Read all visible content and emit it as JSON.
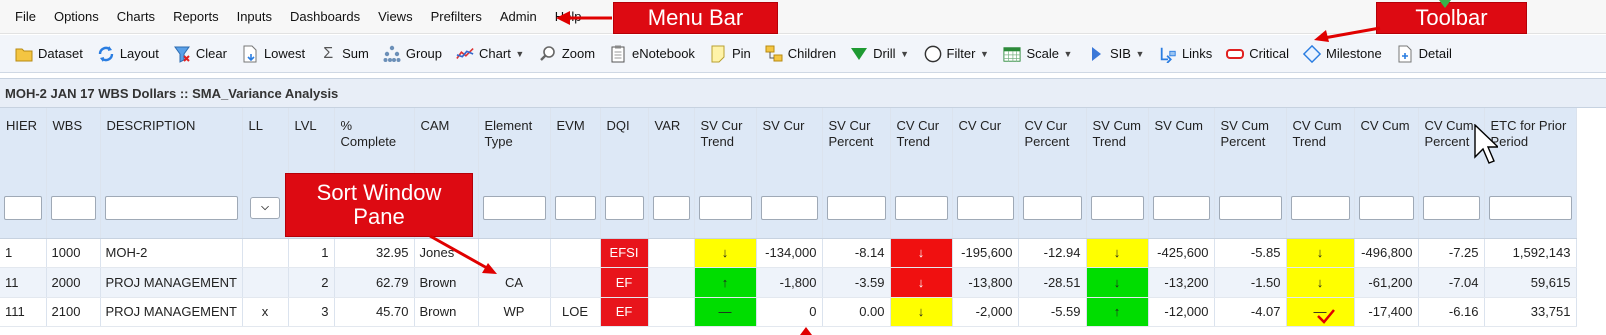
{
  "menu": [
    "File",
    "Options",
    "Charts",
    "Reports",
    "Inputs",
    "Dashboards",
    "Views",
    "Prefilters",
    "Admin",
    "Help"
  ],
  "toolbar": [
    {
      "label": "Dataset",
      "icon": "folder-icon"
    },
    {
      "label": "Layout",
      "icon": "refresh-layout-icon"
    },
    {
      "label": "Clear",
      "icon": "clear-filter-icon"
    },
    {
      "label": "Lowest",
      "icon": "lowest-page-icon"
    },
    {
      "label": "Sum",
      "icon": "sigma-icon"
    },
    {
      "label": "Group",
      "icon": "hierarchy-icon"
    },
    {
      "label": "Chart",
      "icon": "line-chart-icon",
      "dropdown": true
    },
    {
      "label": "Zoom",
      "icon": "magnifier-icon"
    },
    {
      "label": "eNotebook",
      "icon": "notebook-icon"
    },
    {
      "label": "Pin",
      "icon": "note-pin-icon"
    },
    {
      "label": "Children",
      "icon": "children-icon"
    },
    {
      "label": "Drill",
      "icon": "drill-down-triangle-icon",
      "dropdown": true
    },
    {
      "label": "Filter",
      "icon": "filter-circle-icon",
      "dropdown": true
    },
    {
      "label": "Scale",
      "icon": "calendar-scale-icon",
      "dropdown": true
    },
    {
      "label": "SIB",
      "icon": "sib-arrow-icon",
      "dropdown": true
    },
    {
      "label": "Links",
      "icon": "links-icon"
    },
    {
      "label": "Critical",
      "icon": "critical-bar-icon"
    },
    {
      "label": "Milestone",
      "icon": "milestone-diamond-icon"
    },
    {
      "label": "Detail",
      "icon": "detail-page-icon"
    }
  ],
  "title": "MOH-2 JAN 17 WBS Dollars :: SMA_Variance Analysis",
  "columns": [
    "HIER",
    "WBS",
    "DESCRIPTION",
    "LL",
    "LVL",
    "% Complete",
    "CAM",
    "Element Type",
    "EVM",
    "DQI",
    "VAR",
    "SV Cur Trend",
    "SV Cur",
    "SV Cur Percent",
    "CV Cur Trend",
    "CV Cur",
    "CV Cur Percent",
    "SV Cum Trend",
    "SV Cum",
    "SV Cum Percent",
    "CV Cum Trend",
    "CV Cum",
    "CV Cum Percent",
    "ETC for Prior Period"
  ],
  "rows": [
    {
      "hier": "1",
      "wbs": "1000",
      "desc": "MOH-2",
      "ll": "",
      "lvl": "1",
      "pct": "32.95",
      "cam": "Jones",
      "etype": "",
      "evm": "",
      "dqi": "EFSI",
      "var": "",
      "sv_cur_trend": "↓",
      "sv_cur": "-134,000",
      "sv_cur_pct": "-8.14",
      "cv_cur_trend": "↓",
      "cv_cur": "-195,600",
      "cv_cur_pct": "-12.94",
      "sv_cum_trend": "↓",
      "sv_cum": "-425,600",
      "sv_cum_pct": "-5.85",
      "cv_cum_trend": "↓",
      "cv_cum": "-496,800",
      "cv_cum_pct": "-7.25",
      "etc": "1,592,143"
    },
    {
      "hier": "11",
      "wbs": "2000",
      "desc": "PROJ MANAGEMENT",
      "ll": "",
      "lvl": "2",
      "pct": "62.79",
      "cam": "Brown",
      "etype": "CA",
      "evm": "",
      "dqi": "EF",
      "var": "",
      "sv_cur_trend": "↑",
      "sv_cur": "-1,800",
      "sv_cur_pct": "-3.59",
      "cv_cur_trend": "↓",
      "cv_cur": "-13,800",
      "cv_cur_pct": "-28.51",
      "sv_cum_trend": "↓",
      "sv_cum": "-13,200",
      "sv_cum_pct": "-1.50",
      "cv_cum_trend": "↓",
      "cv_cum": "-61,200",
      "cv_cum_pct": "-7.04",
      "etc": "59,615"
    },
    {
      "hier": "111",
      "wbs": "2100",
      "desc": "PROJ MANAGEMENT",
      "ll": "x",
      "lvl": "3",
      "pct": "45.70",
      "cam": "Brown",
      "etype": "WP",
      "evm": "LOE",
      "dqi": "EF",
      "var": "",
      "sv_cur_trend": "—",
      "sv_cur": "0",
      "sv_cur_pct": "0.00",
      "cv_cur_trend": "↓",
      "cv_cur": "-2,000",
      "cv_cur_pct": "-5.59",
      "sv_cum_trend": "↑",
      "sv_cum": "-12,000",
      "sv_cum_pct": "-4.07",
      "cv_cum_trend": "—",
      "cv_cum": "-17,400",
      "cv_cum_pct": "-6.16",
      "etc": "33,751"
    }
  ],
  "trend_colors": {
    "row1": {
      "sv_cur": "yellow",
      "cv_cur": "red",
      "sv_cum": "yellow",
      "cv_cum": "yellow"
    },
    "row2": {
      "sv_cur": "green",
      "cv_cur": "red",
      "sv_cum": "green",
      "cv_cum": "yellow"
    },
    "row3": {
      "sv_cur": "green",
      "cv_cur": "yellow",
      "sv_cum": "green",
      "cv_cum": "yellow"
    }
  },
  "callouts": {
    "menu_bar": "Menu Bar",
    "toolbar": "Toolbar",
    "sort_pane_line1": "Sort Window",
    "sort_pane_line2": "Pane"
  },
  "colors": {
    "callout": "#dd0a12",
    "dqi": "#e8141b",
    "trend_yellow": "#ffff00",
    "trend_green": "#00dd00",
    "trend_red": "#f01010",
    "header_bg": "#dde8f6"
  }
}
